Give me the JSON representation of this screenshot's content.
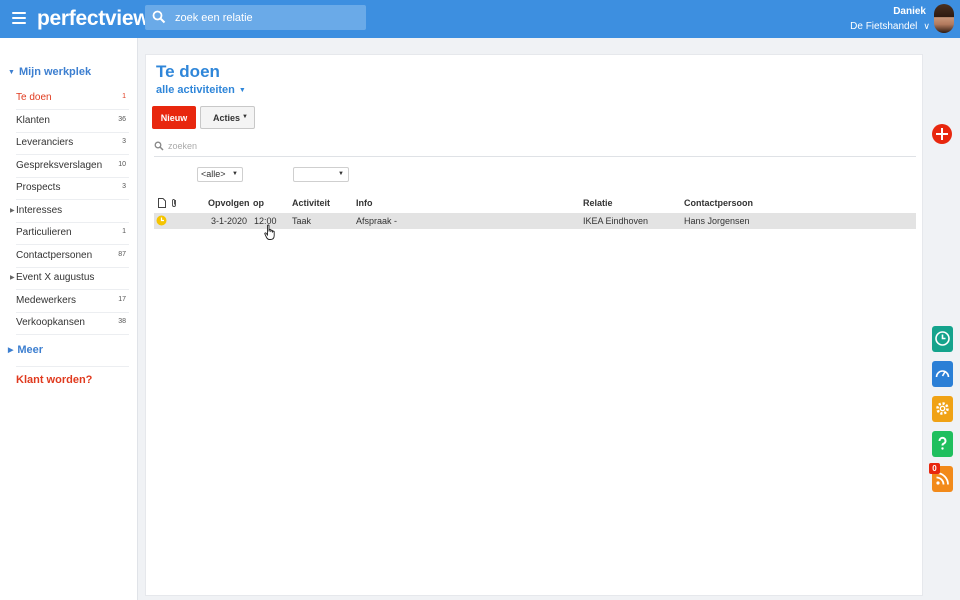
{
  "header": {
    "logo": "perfectview",
    "search_placeholder": "zoek een relatie",
    "user_name": "Daniek",
    "user_company": "De Fietshandel"
  },
  "sidebar": {
    "section_title": "Mijn werkplek",
    "items": [
      {
        "label": "Te doen",
        "count": "1",
        "active": true
      },
      {
        "label": "Klanten",
        "count": "36"
      },
      {
        "label": "Leveranciers",
        "count": "3"
      },
      {
        "label": "Gespreksverslagen",
        "count": "10"
      },
      {
        "label": "Prospects",
        "count": "3"
      },
      {
        "label": "Interesses",
        "count": "",
        "expandable": true
      },
      {
        "label": "Particulieren",
        "count": "1"
      },
      {
        "label": "Contactpersonen",
        "count": "87"
      },
      {
        "label": "Event X augustus",
        "count": "",
        "expandable": true
      },
      {
        "label": "Medewerkers",
        "count": "17"
      },
      {
        "label": "Verkoopkansen",
        "count": "38"
      }
    ],
    "more_label": "Meer",
    "cta_label": "Klant worden?"
  },
  "main": {
    "title": "Te doen",
    "filter_label": "alle activiteiten",
    "new_button": "Nieuw",
    "actions_button": "Acties",
    "search_placeholder": "zoeken",
    "select_type_value": "<alle>",
    "select_status_value": "",
    "columns": [
      "Opvolgen",
      "op",
      "Activiteit",
      "Info",
      "Relatie",
      "Contactpersoon"
    ],
    "rows": [
      {
        "opvolgen": "3-1-2020",
        "op": "12:00",
        "activiteit": "Taak",
        "info": "Afspraak -",
        "relatie": "IKEA Eindhoven",
        "contactpersoon": "Hans Jorgensen"
      }
    ]
  },
  "right_toolbar": {
    "notification_count": "0",
    "icons": [
      "add-icon",
      "history-icon",
      "dashboard-icon",
      "settings-icon",
      "help-icon",
      "rss-icon"
    ]
  },
  "colors": {
    "topbar": "#3d8fe0",
    "accent_blue": "#2f86d9",
    "accent_red": "#e8270e"
  }
}
